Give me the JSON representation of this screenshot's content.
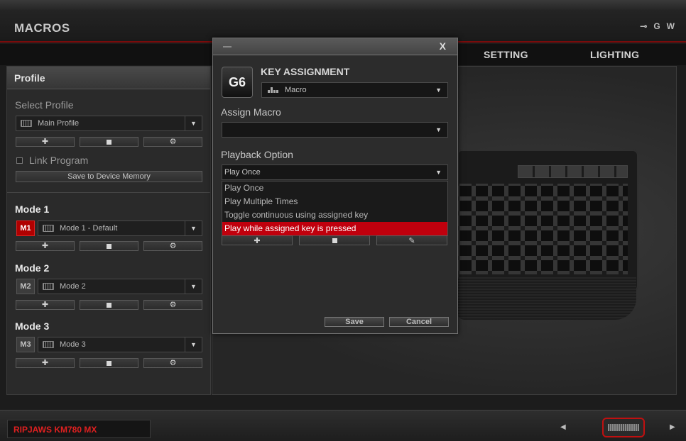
{
  "app": {
    "title": "MACROS",
    "header_icons": [
      {
        "name": "key-icon",
        "glyph": "⊸"
      },
      {
        "name": "g-icon",
        "glyph": "G"
      },
      {
        "name": "w-icon",
        "glyph": "W"
      }
    ]
  },
  "nav": {
    "tabs": [
      "SETTING",
      "LIGHTING"
    ]
  },
  "profile_panel": {
    "heading": "Profile",
    "select_label": "Select Profile",
    "profile_value": "Main Profile",
    "link_program_label": "Link Program",
    "link_program_checked": false,
    "save_memory_label": "Save to Device Memory",
    "button_icons": [
      "plus-icon",
      "trash-icon",
      "gear-icon"
    ]
  },
  "modes": [
    {
      "title": "Mode 1",
      "badge": "M1",
      "value": "Mode 1 - Default",
      "active": true
    },
    {
      "title": "Mode 2",
      "badge": "M2",
      "value": "Mode 2",
      "active": false
    },
    {
      "title": "Mode 3",
      "badge": "M3",
      "value": "Mode 3",
      "active": false
    }
  ],
  "dialog": {
    "close_label": "X",
    "key": "G6",
    "title": "KEY ASSIGNMENT",
    "assignment_type": "Macro",
    "assign_macro_label": "Assign Macro",
    "assign_macro_value": "",
    "playback_label": "Playback Option",
    "playback_value": "Play Once",
    "playback_options": [
      "Play Once",
      "Play Multiple Times",
      "Toggle continuous using assigned key",
      "Play while assigned key is pressed"
    ],
    "highlighted_option": 3,
    "save_label": "Save",
    "cancel_label": "Cancel"
  },
  "footer": {
    "device_name": "RIPJAWS KM780 MX"
  },
  "colors": {
    "accent_red": "#c0000d",
    "background": "#1c1c1c",
    "panel": "#2a2a2a"
  }
}
